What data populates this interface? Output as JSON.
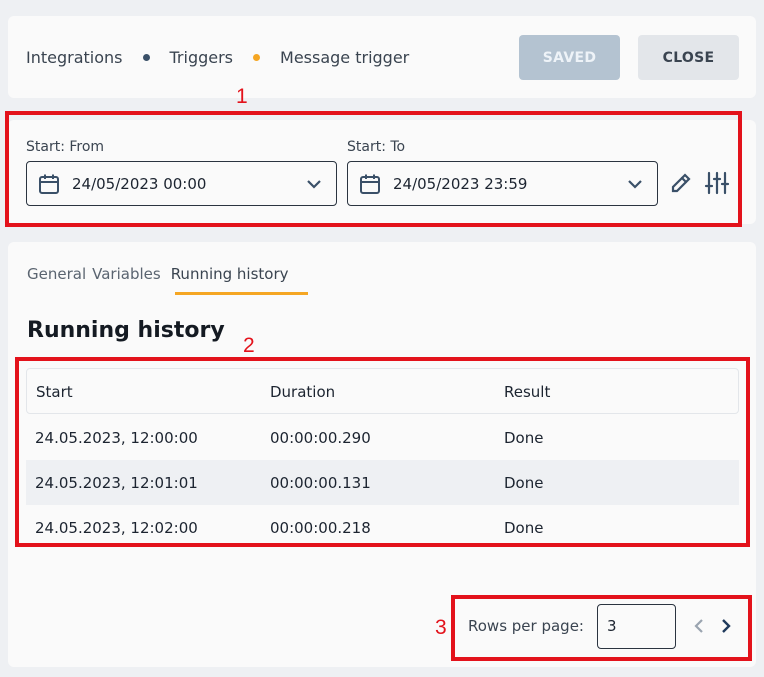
{
  "breadcrumb": {
    "items": [
      "Integrations",
      "Triggers",
      "Message trigger"
    ],
    "dot_colors": [
      "#3a5068",
      "#f5a623"
    ]
  },
  "actions": {
    "saved_label": "SAVED",
    "close_label": "CLOSE"
  },
  "filters": {
    "from": {
      "label": "Start: From",
      "value": "24/05/2023 00:00"
    },
    "to": {
      "label": "Start: To",
      "value": "24/05/2023 23:59"
    }
  },
  "tabs": [
    {
      "label": "General",
      "active": false
    },
    {
      "label": "Variables",
      "active": false
    },
    {
      "label": "Running history",
      "active": true
    }
  ],
  "section": {
    "title": "Running history"
  },
  "table": {
    "columns": [
      "Start",
      "Duration",
      "Result"
    ],
    "rows": [
      [
        "24.05.2023, 12:00:00",
        "00:00:00.290",
        "Done"
      ],
      [
        "24.05.2023, 12:01:01",
        "00:00:00.131",
        "Done"
      ],
      [
        "24.05.2023, 12:02:00",
        "00:00:00.218",
        "Done"
      ]
    ]
  },
  "pagination": {
    "rows_per_page_label": "Rows per page:",
    "rows_per_page_value": "3"
  },
  "annotations": {
    "n1": "1",
    "n2": "2",
    "n3": "3"
  },
  "colors": {
    "accent": "#f5a623",
    "annotation": "#e3121b",
    "saved_button": "#b4c3d1"
  },
  "icons": [
    "calendar-icon",
    "chevron-down-icon",
    "pencil-icon",
    "sliders-icon",
    "chevron-left-icon",
    "chevron-right-icon"
  ]
}
